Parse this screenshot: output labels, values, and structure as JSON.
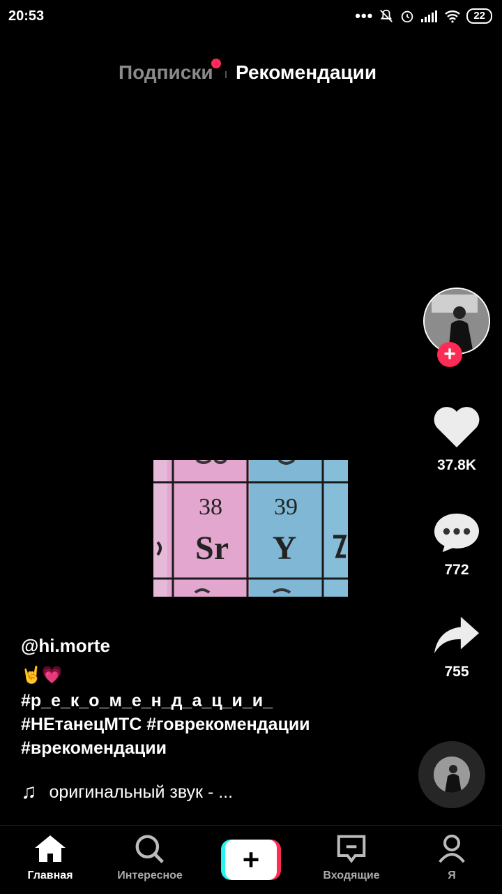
{
  "status_bar": {
    "time": "20:53",
    "battery": "22"
  },
  "top_tabs": {
    "following": "Подписки",
    "for_you": "Рекомендации"
  },
  "video": {
    "cells": [
      {
        "number": "38",
        "symbol": "Sr"
      },
      {
        "number": "39",
        "symbol": "Y"
      }
    ]
  },
  "actions": {
    "likes": "37.8K",
    "comments": "772",
    "shares": "755"
  },
  "caption": {
    "username": "@hi.morte",
    "emoji": "🤘💗",
    "hashtag_lines": [
      "#р_е_к_о_м_е_н_д_а_ц_и_и_",
      "#НЕтанецМТС #говрекомендации",
      "#врекомендации"
    ]
  },
  "music": {
    "title": "оригинальный звук - ..."
  },
  "bottom_nav": {
    "home": "Главная",
    "discover": "Интересное",
    "inbox": "Входящие",
    "me": "Я"
  },
  "colors": {
    "accent": "#fe2c55",
    "cyan": "#25f4ee"
  }
}
